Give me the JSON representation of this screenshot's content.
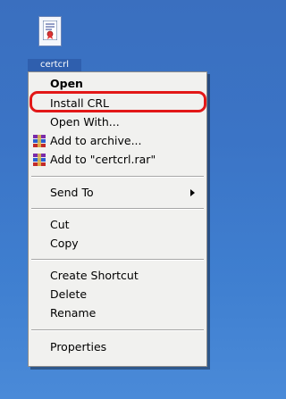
{
  "desktop": {
    "file_label": "certcrl"
  },
  "context_menu": {
    "items": [
      {
        "label": "Open",
        "bold": true,
        "icon": "none"
      },
      {
        "label": "Install CRL",
        "bold": false,
        "icon": "none",
        "highlighted_by_annotation": true
      },
      {
        "label": "Open With...",
        "bold": false,
        "icon": "none"
      },
      {
        "label": "Add to archive...",
        "bold": false,
        "icon": "winrar-icon"
      },
      {
        "label": "Add to \"certcrl.rar\"",
        "bold": false,
        "icon": "winrar-icon"
      },
      {
        "label": "Send To",
        "bold": false,
        "icon": "none",
        "has_submenu": true
      },
      {
        "label": "Cut",
        "bold": false,
        "icon": "none"
      },
      {
        "label": "Copy",
        "bold": false,
        "icon": "none"
      },
      {
        "label": "Create Shortcut",
        "bold": false,
        "icon": "none"
      },
      {
        "label": "Delete",
        "bold": false,
        "icon": "none"
      },
      {
        "label": "Rename",
        "bold": false,
        "icon": "none"
      },
      {
        "label": "Properties",
        "bold": false,
        "icon": "none"
      }
    ]
  },
  "colors": {
    "annotation_ring": "#e21818",
    "menu_background": "#f1f1ef",
    "desktop_background": "#3b74c6"
  }
}
